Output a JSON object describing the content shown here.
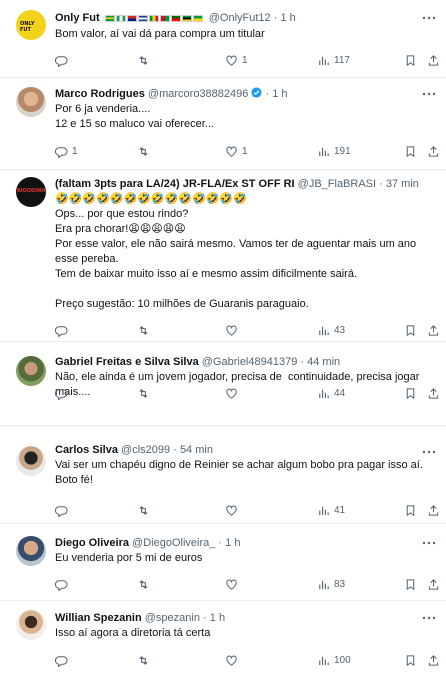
{
  "tweets": [
    {
      "name": "Only Fut",
      "handle": "@OnlyFut12",
      "time": "1 h",
      "verified": false,
      "text": "Bom valor, aí vai dá para compra um titular",
      "replies": "",
      "retweets": "",
      "likes": "1",
      "views": "117",
      "avatar": "only-fut-logo"
    },
    {
      "name": "Marco Rodrigues",
      "handle": "@marcoro38882496",
      "time": "1 h",
      "verified": true,
      "text": "Por 6 ja venderia....\n12 e 15 so maluco vai oferecer...",
      "replies": "1",
      "retweets": "",
      "likes": "1",
      "views": "191",
      "avatar": "person-photo"
    },
    {
      "name": "(faltam 3pts para LA/24) JR-FLA/Ex ST OFF RI",
      "handle": "@JB_FlaBRASI",
      "time": "37 min",
      "verified": false,
      "text": "🤣🤣🤣🤣🤣🤣🤣🤣🤣🤣🤣🤣🤣🤣\nOps... por que estou rindo?\nEra pra chorar!😩😩😩😩😩\nPor esse valor, ele não sairá mesmo. Vamos ter de aguentar mais um ano esse pereba.\nTem de baixar muito isso aí e mesmo assim dificilmente sairá.\n\nPreço sugestão: 10 milhões de Guaranis paraguaio.",
      "replies": "",
      "retweets": "",
      "likes": "",
      "views": "43",
      "avatar": "bigodinho-logo"
    },
    {
      "name": "Gabriel Freitas e Silva Silva",
      "handle": "@Gabriel48941379",
      "time": "44 min",
      "verified": false,
      "text": "Não, ele ainda é um jovem jogador, precisa de  continuidade, precisa jogar mais....",
      "replies": "",
      "retweets": "",
      "likes": "",
      "views": "44",
      "avatar": "person-photo"
    },
    {
      "name": "Carlos Silva",
      "handle": "@cls2099",
      "time": "54 min",
      "verified": false,
      "text": "Vai ser um chapéu digno de Reinier se achar algum bobo pra pagar isso aí. Boto fé!",
      "replies": "",
      "retweets": "",
      "likes": "",
      "views": "41",
      "avatar": "person-photo"
    },
    {
      "name": "Diego Oliveira",
      "handle": "@DiegoOliveira_",
      "time": "1 h",
      "verified": false,
      "text": "Eu venderia por 5 mi de euros",
      "replies": "",
      "retweets": "",
      "likes": "",
      "views": "83",
      "avatar": "person-photo"
    },
    {
      "name": "Willian Spezanin",
      "handle": "@spezanin",
      "time": "1 h",
      "verified": false,
      "text": "Isso aí agora a diretoria tá certa",
      "replies": "",
      "retweets": "",
      "likes": "",
      "views": "100",
      "avatar": "person-photo"
    }
  ],
  "separator": "·",
  "colors": {
    "text": "#0f1419",
    "muted": "#536471",
    "border": "#e6ecf0",
    "verified": "#1d9bf0"
  },
  "icons": [
    "reply-icon",
    "retweet-icon",
    "like-icon",
    "views-icon",
    "bookmark-icon",
    "share-icon",
    "more-icon"
  ]
}
